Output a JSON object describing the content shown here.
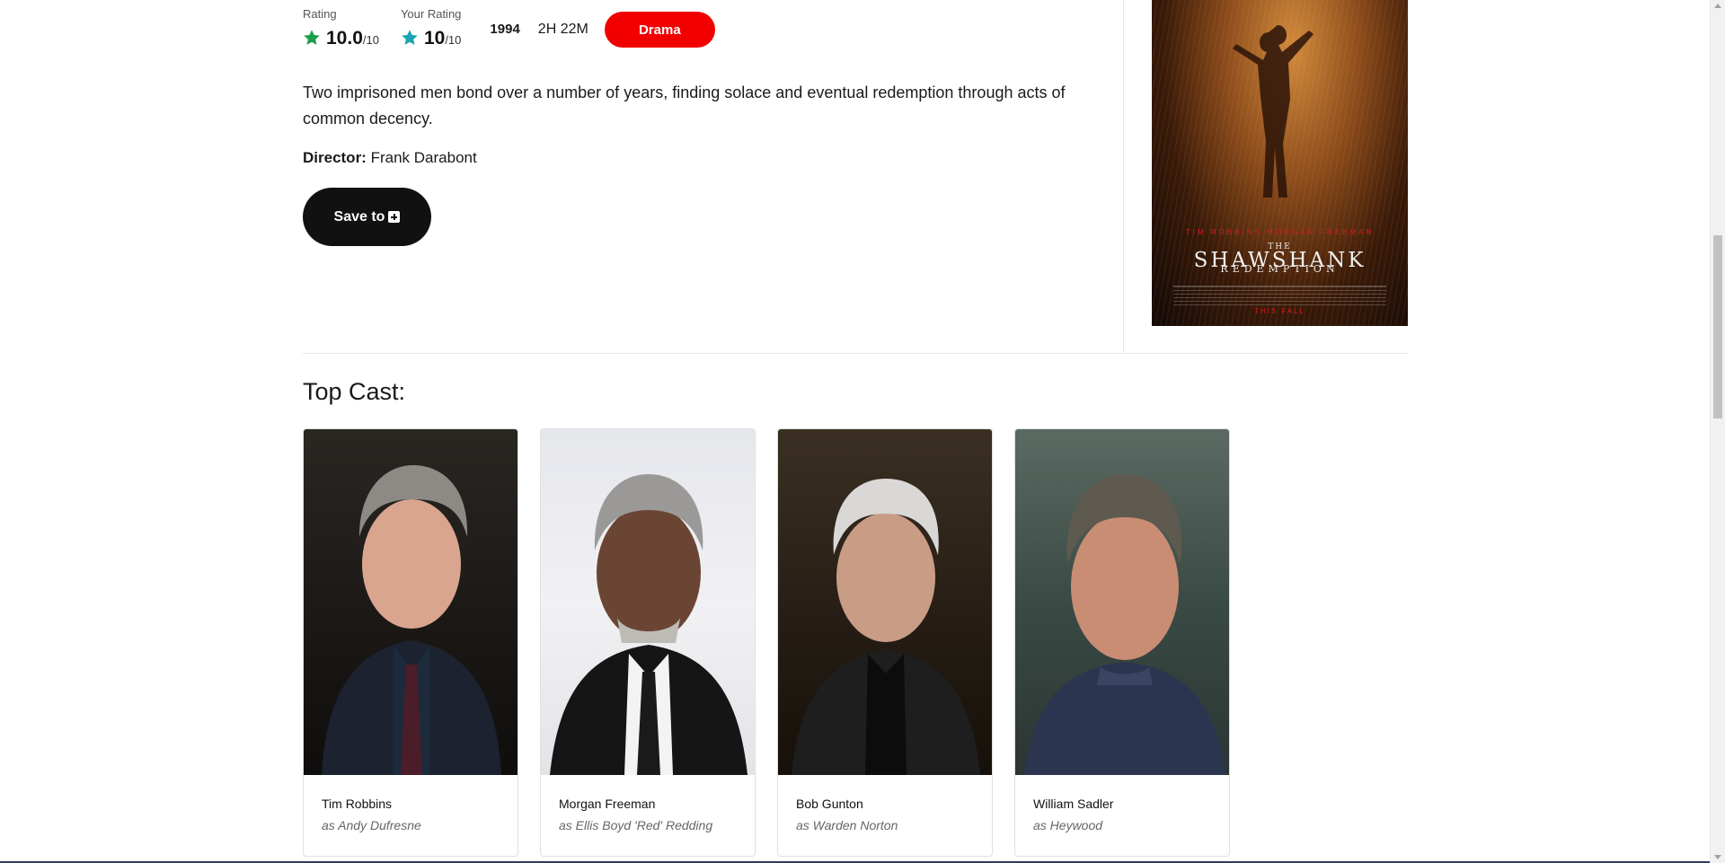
{
  "movie": {
    "rating_label": "Rating",
    "rating_value": "10.0",
    "rating_max": "/10",
    "your_rating_label": "Your Rating",
    "your_rating_value": "10",
    "your_rating_max": "/10",
    "year": "1994",
    "runtime": "2H 22M",
    "genre": "Drama",
    "plot": "Two imprisoned men bond over a number of years, finding solace and eventual redemption through acts of common decency.",
    "director_label": "Director:",
    "director_name": "Frank Darabont",
    "save_label": "Save to",
    "colors": {
      "rating_star": "#1e9e4a",
      "your_rating_star": "#1aa3b0",
      "genre_bg": "#f20000",
      "save_bg": "#111111"
    }
  },
  "poster": {
    "cast_line": "TIM ROBBINS    MORGAN FREEMAN",
    "title_prefix": "THE",
    "title": "SHAWSHANK",
    "subtitle": "REDEMPTION",
    "tagline": "THIS FALL"
  },
  "cast": {
    "heading": "Top Cast:",
    "members": [
      {
        "name": "Tim Robbins",
        "role": "as Andy Dufresne"
      },
      {
        "name": "Morgan Freeman",
        "role": "as Ellis Boyd 'Red' Redding"
      },
      {
        "name": "Bob Gunton",
        "role": "as Warden Norton"
      },
      {
        "name": "William Sadler",
        "role": "as Heywood"
      }
    ]
  }
}
